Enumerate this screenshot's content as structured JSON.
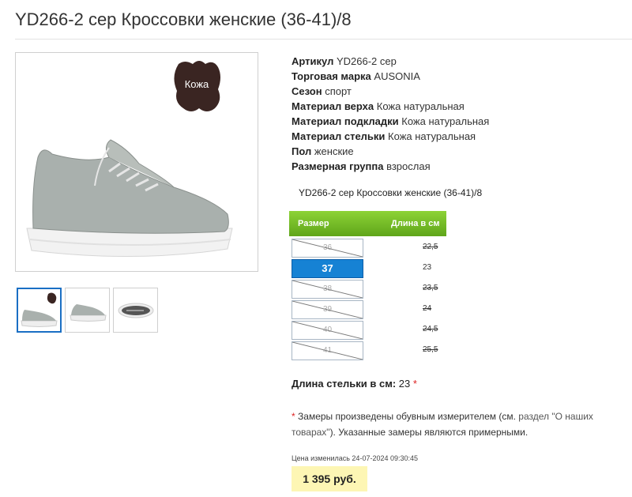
{
  "product": {
    "title": "YD266-2 сер Кроссовки женские (36-41)/8",
    "leather_badge": "Кожа"
  },
  "attributes": [
    {
      "label": "Артикул",
      "value": "YD266-2 сер"
    },
    {
      "label": "Торговая марка",
      "value": "AUSONIA"
    },
    {
      "label": "Сезон",
      "value": "спорт"
    },
    {
      "label": "Материал верха",
      "value": "Кожа натуральная"
    },
    {
      "label": "Материал подкладки",
      "value": "Кожа натуральная"
    },
    {
      "label": "Материал стельки",
      "value": "Кожа натуральная"
    },
    {
      "label": "Пол",
      "value": "женские"
    },
    {
      "label": "Размерная группа",
      "value": "взрослая"
    }
  ],
  "size_table": {
    "caption": "YD266-2 сер Кроссовки женские (36-41)/8",
    "header_size": "Размер",
    "header_length": "Длина в см",
    "rows": [
      {
        "size": "36",
        "length": "22,5",
        "available": false,
        "selected": false
      },
      {
        "size": "37",
        "length": "23",
        "available": true,
        "selected": true
      },
      {
        "size": "38",
        "length": "23,5",
        "available": false,
        "selected": false
      },
      {
        "size": "39",
        "length": "24",
        "available": false,
        "selected": false
      },
      {
        "size": "40",
        "length": "24,5",
        "available": false,
        "selected": false
      },
      {
        "size": "41",
        "length": "25,5",
        "available": false,
        "selected": false
      }
    ]
  },
  "insole": {
    "label": "Длина стельки в см:",
    "value": "23",
    "asterisk": "*"
  },
  "note": {
    "asterisk": "*",
    "text_before": "Замеры произведены обувным измерителем (см.",
    "link_text": "раздел \"О наших товарах\"",
    "text_after": "). Указанные замеры являются примерными."
  },
  "price": {
    "changed_label": "Цена изменилась 24-07-2024 09:30:45",
    "value": "1 395 руб."
  },
  "colors": {
    "accent_green": "#6fb924",
    "selected_blue": "#1682d4",
    "price_bg": "#fdf6b4"
  }
}
